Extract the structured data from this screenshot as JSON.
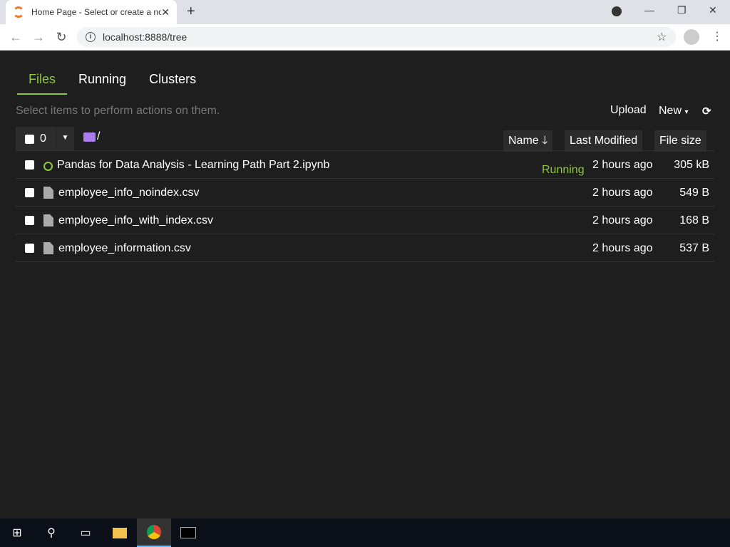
{
  "browser": {
    "tab_title": "Home Page - Select or create a notebook",
    "url": "localhost:8888/tree"
  },
  "tabs": [
    "Files",
    "Running",
    "Clusters"
  ],
  "toolbar": {
    "hint": "Select items to perform actions on them.",
    "upload": "Upload",
    "new": "New",
    "selected_count": "0",
    "path": "/"
  },
  "headers": {
    "name": "Name",
    "modified": "Last Modified",
    "size": "File size"
  },
  "files": [
    {
      "name": "Pandas for Data Analysis - Learning Path Part 2.ipynb",
      "type": "notebook",
      "status": "Running",
      "modified": "2 hours ago",
      "size": "305 kB"
    },
    {
      "name": "employee_info_noindex.csv",
      "type": "file",
      "status": "",
      "modified": "2 hours ago",
      "size": "549 B"
    },
    {
      "name": "employee_info_with_index.csv",
      "type": "file",
      "status": "",
      "modified": "2 hours ago",
      "size": "168 B"
    },
    {
      "name": "employee_information.csv",
      "type": "file",
      "status": "",
      "modified": "2 hours ago",
      "size": "537 B"
    }
  ]
}
